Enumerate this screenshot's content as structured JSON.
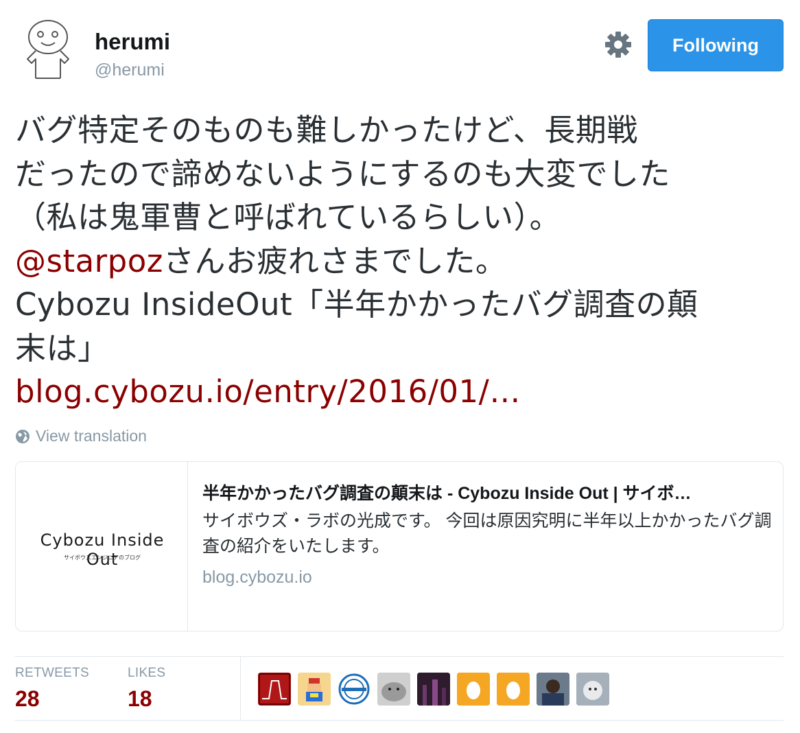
{
  "user": {
    "name": "herumi",
    "handle": "@herumi",
    "follow_label": "Following"
  },
  "tweet": {
    "lines": [
      "バグ特定そのものも難しかったけど、長期戦",
      "だったので諦めないようにするのも大変でした",
      "（私は鬼軍曹と呼ばれているらしい）。"
    ],
    "mention": "@starpoz",
    "mention_rest": "さんお疲れさまでした。",
    "line5": "Cybozu InsideOut「半年かかったバグ調査の顛",
    "line6": "末は」",
    "link": "blog.cybozu.io/entry/2016/01/…"
  },
  "view_translation": "View translation",
  "card": {
    "logo_text": "Cybozu Inside Out",
    "logo_sub": "サイボウズエンジニアのブログ",
    "title": "半年かかったバグ調査の顛末は - Cybozu Inside Out | サイボ…",
    "desc": "サイボウズ・ラボの光成です。 今回は原因究明に半年以上かかったバグ調査の紹介をいたします。",
    "domain": "blog.cybozu.io"
  },
  "stats": {
    "retweets_label": "RETWEETS",
    "retweets_value": "28",
    "likes_label": "LIKES",
    "likes_value": "18"
  },
  "likers": [
    {
      "icon": "red-waveform-avatar",
      "color": "#a31515"
    },
    {
      "icon": "pixel-character-avatar",
      "color": "#f0a030"
    },
    {
      "icon": "blue-emblem-avatar",
      "color": "#1e6eb8"
    },
    {
      "icon": "hamster-photo-avatar",
      "color": "#b9b9b9"
    },
    {
      "icon": "night-photo-avatar",
      "color": "#4a2c4a"
    },
    {
      "icon": "default-egg-avatar",
      "color": "#f5a623"
    },
    {
      "icon": "default-egg-avatar",
      "color": "#f5a623"
    },
    {
      "icon": "person-photo-avatar",
      "color": "#5a6a7a"
    },
    {
      "icon": "animal-photo-avatar",
      "color": "#9aa5b0"
    }
  ]
}
